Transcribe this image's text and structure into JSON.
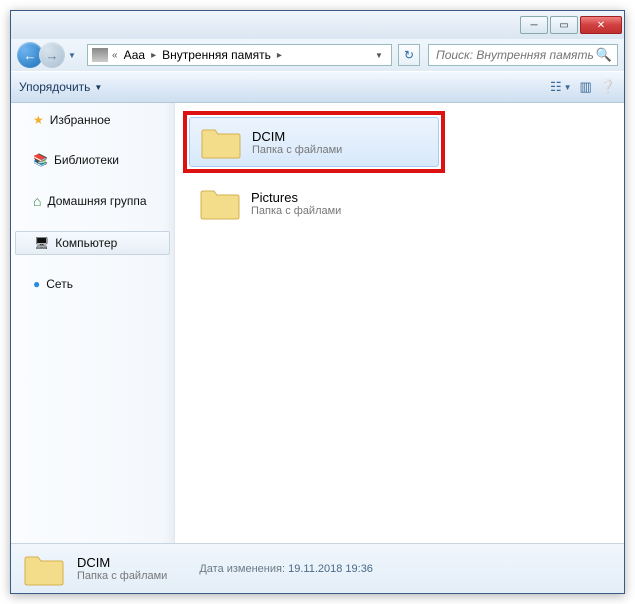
{
  "breadcrumb": {
    "prefix": "«",
    "seg1": "Ааа",
    "seg2": "Внутренняя память"
  },
  "search": {
    "placeholder": "Поиск: Внутренняя память"
  },
  "toolbar": {
    "organize": "Упорядочить"
  },
  "sidebar": {
    "favorites": "Избранное",
    "libraries": "Библиотеки",
    "homegroup": "Домашняя группа",
    "computer": "Компьютер",
    "network": "Сеть"
  },
  "items": [
    {
      "name": "DCIM",
      "sub": "Папка с файлами",
      "selected": true,
      "highlighted": true
    },
    {
      "name": "Pictures",
      "sub": "Папка с файлами",
      "selected": false,
      "highlighted": false
    }
  ],
  "status": {
    "name": "DCIM",
    "sub": "Папка с файлами",
    "meta_label": "Дата изменения:",
    "meta_value": "19.11.2018 19:36"
  }
}
